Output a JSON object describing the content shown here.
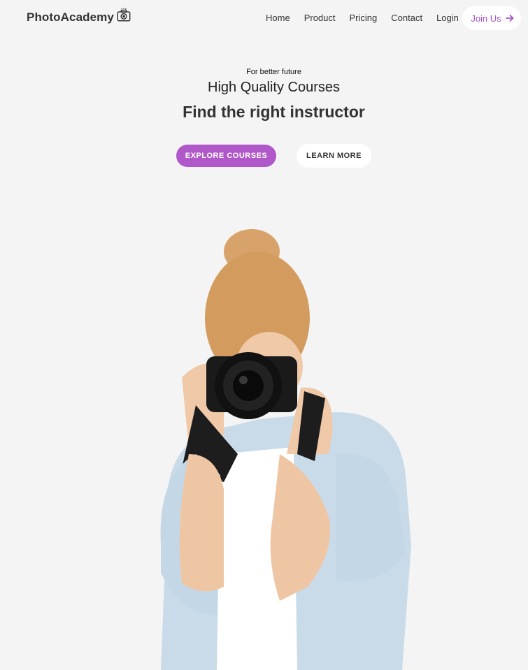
{
  "nav": {
    "brand": "PhotoAcademy",
    "brand_icon": "camera-icon",
    "links": [
      "Home",
      "Product",
      "Pricing",
      "Contact",
      "Login"
    ],
    "join_label": "Join Us",
    "join_icon": "arrow-right-icon"
  },
  "hero": {
    "kicker": "For better future",
    "subtitle": "High Quality Courses",
    "title": "Find the right instructor",
    "explore_label": "EXPLORE COURSES",
    "learn_label": "LEARN MORE"
  },
  "colors": {
    "accent": "#b057c9",
    "background": "#f4f4f4",
    "button_bg": "#ffffff",
    "text": "#333333"
  }
}
